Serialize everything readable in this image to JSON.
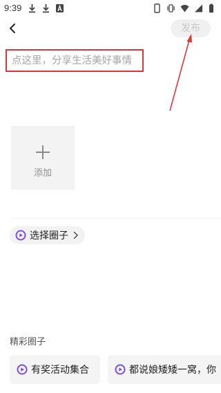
{
  "status_bar": {
    "time": "9:39",
    "left_icons": [
      "download-icon",
      "download-icon",
      "app-a-icon"
    ],
    "right_icons": [
      "phone-icon",
      "vibrate-icon",
      "wifi-icon",
      "signal-icon",
      "battery-icon"
    ]
  },
  "nav": {
    "back_icon": "chevron-left-icon",
    "publish_label": "发布"
  },
  "compose": {
    "placeholder": "点这里，分享生活美好事情",
    "value": ""
  },
  "media": {
    "add_label": "添加"
  },
  "circle": {
    "select_label": "选择圈子"
  },
  "featured": {
    "title": "精彩圈子",
    "items": [
      {
        "label": "有奖活动集合"
      },
      {
        "label": "都说娘矮矮一窝，你"
      }
    ]
  },
  "colors": {
    "annotation_red": "#d9383a",
    "accent_purple": "#7b4cf5",
    "button_bg": "#f0f0f0",
    "button_text": "#c8c8c8"
  }
}
